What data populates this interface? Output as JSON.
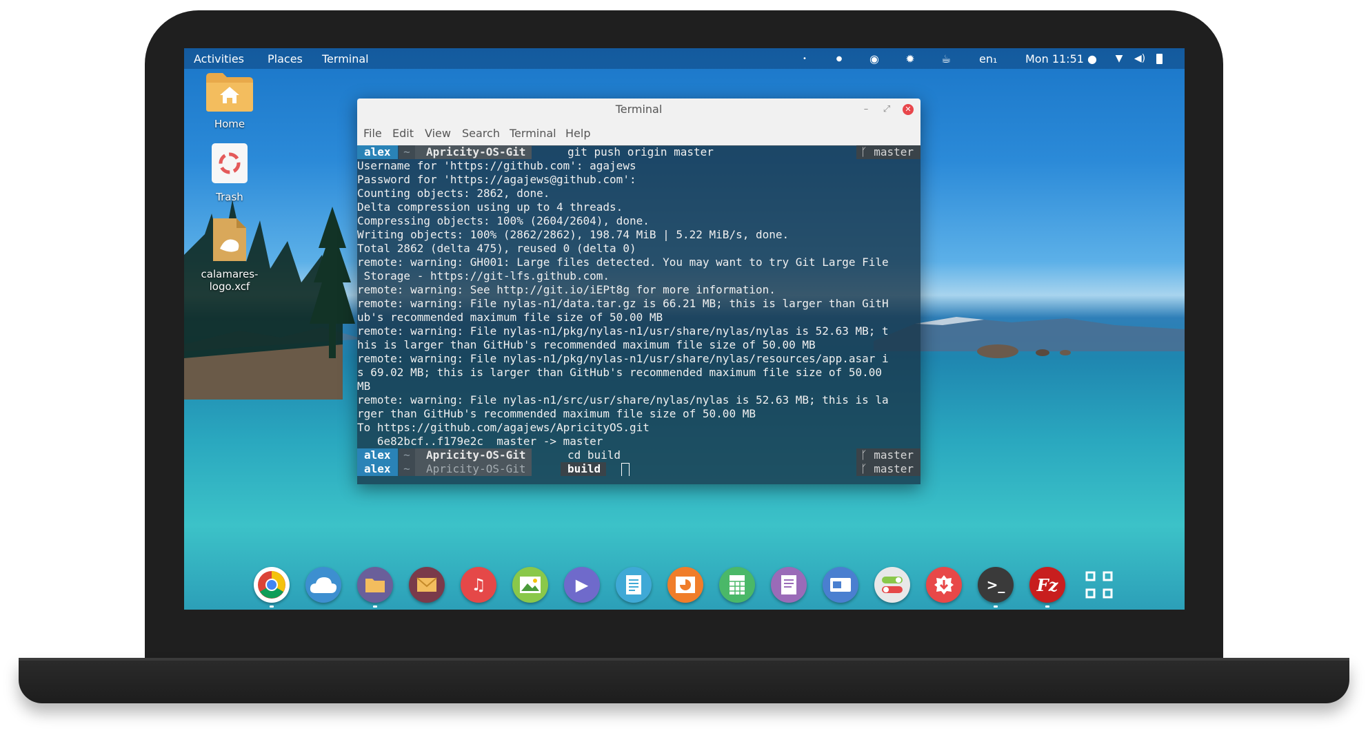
{
  "topbar": {
    "activities": "Activities",
    "places": "Places",
    "terminal": "Terminal",
    "keyboard_layout": "en₁",
    "clock": "Mon 11:51 ●"
  },
  "desktop": {
    "home": "Home",
    "trash": "Trash",
    "file": "calamares-logo.xcf"
  },
  "terminal_window": {
    "title": "Terminal",
    "menu": [
      "File",
      "Edit",
      "View",
      "Search",
      "Terminal",
      "Help"
    ],
    "prompt": {
      "user": "alex",
      "home": "~",
      "dir": "Apricity-OS-Git",
      "branch": "master",
      "build": "build"
    },
    "first_command": "git push origin master",
    "second_command": "cd build",
    "output": [
      "Username for 'https://github.com': agajews",
      "Password for 'https://agajews@github.com':",
      "Counting objects: 2862, done.",
      "Delta compression using up to 4 threads.",
      "Compressing objects: 100% (2604/2604), done.",
      "Writing objects: 100% (2862/2862), 198.74 MiB | 5.22 MiB/s, done.",
      "Total 2862 (delta 475), reused 0 (delta 0)",
      "remote: warning: GH001: Large files detected. You may want to try Git Large File",
      " Storage - https://git-lfs.github.com.",
      "remote: warning: See http://git.io/iEPt8g for more information.",
      "remote: warning: File nylas-n1/data.tar.gz is 66.21 MB; this is larger than GitH",
      "ub's recommended maximum file size of 50.00 MB",
      "remote: warning: File nylas-n1/pkg/nylas-n1/usr/share/nylas/nylas is 52.63 MB; t",
      "his is larger than GitHub's recommended maximum file size of 50.00 MB",
      "remote: warning: File nylas-n1/pkg/nylas-n1/usr/share/nylas/resources/app.asar i",
      "s 69.02 MB; this is larger than GitHub's recommended maximum file size of 50.00",
      "MB",
      "remote: warning: File nylas-n1/src/usr/share/nylas/nylas is 52.63 MB; this is la",
      "rger than GitHub's recommended maximum file size of 50.00 MB",
      "To https://github.com/agajews/ApricityOS.git",
      "   6e82bcf..f179e2c  master -> master"
    ]
  },
  "dock": {
    "apps": [
      {
        "name": "chrome",
        "color": "#ffffff"
      },
      {
        "name": "cloud",
        "color": "#3d8fd0"
      },
      {
        "name": "files",
        "color": "#6a5f9a"
      },
      {
        "name": "mail",
        "color": "#7a3a4a"
      },
      {
        "name": "music",
        "color": "#e54848"
      },
      {
        "name": "photos",
        "color": "#8ac84a"
      },
      {
        "name": "videos",
        "color": "#6f6acb"
      },
      {
        "name": "documents",
        "color": "#3fa9d6"
      },
      {
        "name": "impress",
        "color": "#f07d2a"
      },
      {
        "name": "calc",
        "color": "#4ab868"
      },
      {
        "name": "writer",
        "color": "#9a6bb8"
      },
      {
        "name": "remote",
        "color": "#4a7fd0"
      },
      {
        "name": "settings",
        "color": "#e8e8e8"
      },
      {
        "name": "software",
        "color": "#e84848"
      },
      {
        "name": "terminal",
        "color": "#3a3a3a"
      },
      {
        "name": "filezilla",
        "color": "#c81e1e"
      },
      {
        "name": "app-grid",
        "color": "transparent"
      }
    ]
  }
}
